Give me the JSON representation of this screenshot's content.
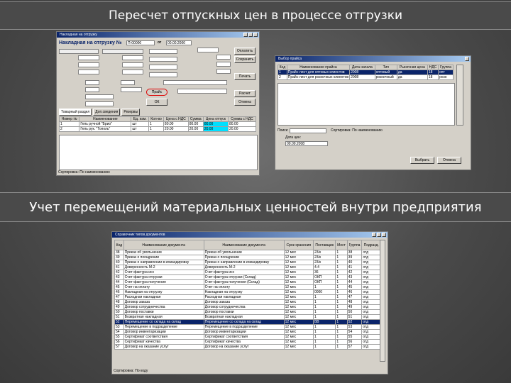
{
  "slide": {
    "heading_top": "Пересчет отпускных цен в процессе отгрузки",
    "heading_bottom": "Учет перемещений материальных ценностей внутри предприятия"
  },
  "win1": {
    "title": "Накладная на отгрузку",
    "doc_label": "Накладная на отгрузку №",
    "doc_no": "П-00000",
    "date_label": "от",
    "date": "00.00.2000",
    "ok_label": "Оплатить",
    "button_ok": "ОК",
    "button_price": "Прайс",
    "button_save": "Сохранить",
    "button_cancel": "Отмена",
    "button_print": "Печать",
    "button_calc": "Расчет",
    "tab_labels": [
      "Товарный раздел",
      "Доп.сведения",
      "Резервы"
    ],
    "table_headers": [
      "Номер №",
      "Наименование",
      "Ед. изм.",
      "Кол-во",
      "Цена с НДС",
      "Сумма",
      "Цена отпуск",
      "Сумма с НДС"
    ],
    "rows": [
      {
        "no": "1",
        "name": "Гель ручной \"Брио\"",
        "unit": "шт",
        "qty": "1",
        "price": "80.00",
        "sum": "80.00",
        "cprice": "80.00",
        "csum": "80.00"
      },
      {
        "no": "2",
        "name": "Гель рук. \"Тополь\"",
        "unit": "шт",
        "qty": "1",
        "price": "20.00",
        "sum": "20.00",
        "cprice": "20.00",
        "csum": "20.00"
      }
    ],
    "status": "Сортировка: По наименованию"
  },
  "win2": {
    "title": "Выбор прайса",
    "table_headers": [
      "Код",
      "Наименование прайса",
      "Дата начала",
      "Тип",
      "Рыночная цена",
      "НДС",
      "Группа"
    ],
    "rows": [
      {
        "code": "1",
        "name": "Прайс-лист для оптовых клиентов",
        "date": "2008",
        "type": "оптовый",
        "market": "да",
        "nds": "18",
        "group": "опт"
      },
      {
        "code": "2",
        "name": "Прайс-лист для розничных клиентов",
        "date": "2008",
        "type": "розничный",
        "market": "да",
        "nds": "18",
        "group": "розн"
      }
    ],
    "filter_label": "Поиск:",
    "sort_label": "Сортировка: По наименованию",
    "date_label": "Дата цен:",
    "date_value": "09.09.2008",
    "button_select": "Выбрать",
    "button_cancel": "Отмена"
  },
  "win3": {
    "title": "Справочник типов документов",
    "table_headers": [
      "Код",
      "Наименование документа",
      "Наименование документа",
      "Срок хранения",
      "Поставщик",
      "Мест",
      "Группа",
      "Подразд."
    ],
    "rows": [
      {
        "code": "38",
        "n1": "Приказ об увольнении",
        "n2": "Приказ об увольнении",
        "s": "12 мес",
        "p": "23/к",
        "m": "1",
        "g": "38",
        "d": "отд"
      },
      {
        "code": "39",
        "n1": "Приказ о поощрении",
        "n2": "Приказ о поощрении",
        "s": "12 мес",
        "p": "23/к",
        "m": "1",
        "g": "39",
        "d": "отд"
      },
      {
        "code": "40",
        "n1": "Приказ о направлении в командировку",
        "n2": "Приказ о направлении в командировку",
        "s": "12 мес",
        "p": "23/к",
        "m": "1",
        "g": "40",
        "d": "отд"
      },
      {
        "code": "41",
        "n1": "Доверенность М-2",
        "n2": "Доверенность М-2",
        "s": "12 мес",
        "p": "4.4",
        "m": "1",
        "g": "41",
        "d": "отд"
      },
      {
        "code": "42",
        "n1": "Счет-фактура исх",
        "n2": "Счет-фактура исх",
        "s": "12 мес",
        "p": "36",
        "m": "1",
        "g": "42",
        "d": "отд"
      },
      {
        "code": "43",
        "n1": "Счет-фактура отгрузки",
        "n2": "Счет-фактура отгрузки (Склад)",
        "s": "12 мес",
        "p": "ОКП",
        "m": "1",
        "g": "43",
        "d": "отд"
      },
      {
        "code": "44",
        "n1": "Счет-фактура получения",
        "n2": "Счет-фактура получения (Склад)",
        "s": "12 мес",
        "p": "ОКП",
        "m": "1",
        "g": "44",
        "d": "отд"
      },
      {
        "code": "45",
        "n1": "Счет на оплату",
        "n2": "Счет на оплату",
        "s": "12 мес",
        "p": "1",
        "m": "1",
        "g": "45",
        "d": "отд"
      },
      {
        "code": "46",
        "n1": "Накладная на отгрузку",
        "n2": "Накладная на отгрузку",
        "s": "12 мес",
        "p": "0000",
        "m": "1",
        "g": "46",
        "d": "отд"
      },
      {
        "code": "47",
        "n1": "Расходная накладная",
        "n2": "Расходная накладная",
        "s": "12 мес",
        "p": "1",
        "m": "1",
        "g": "47",
        "d": "отд"
      },
      {
        "code": "48",
        "n1": "Договор заказа",
        "n2": "Договор заказа",
        "s": "12 мес",
        "p": "1",
        "m": "1",
        "g": "48",
        "d": "отд"
      },
      {
        "code": "49",
        "n1": "Договор сотрудничества",
        "n2": "Договор сотрудничества",
        "s": "12 мес",
        "p": "1",
        "m": "1",
        "g": "49",
        "d": "отд"
      },
      {
        "code": "50",
        "n1": "Договор поставки",
        "n2": "Договор поставки",
        "s": "12 мес",
        "p": "1",
        "m": "1",
        "g": "50",
        "d": "отд"
      },
      {
        "code": "51",
        "n1": "Возвратная накладная",
        "n2": "Возвратная накладная",
        "s": "12 мес",
        "p": "1",
        "m": "1",
        "g": "51",
        "d": "отд"
      },
      {
        "code": "52",
        "n1": "Перемещение со склада на склад",
        "n2": "Перемещение со склада на склад",
        "s": "12 мес",
        "p": "ВВ",
        "m": "1",
        "g": "52",
        "d": "отд"
      },
      {
        "code": "53",
        "n1": "Перемещение в подразделение",
        "n2": "Перемещение в подразделение",
        "s": "12 мес",
        "p": "1",
        "m": "1",
        "g": "53",
        "d": "отд"
      },
      {
        "code": "54",
        "n1": "Договор инвентаризации",
        "n2": "Договор инвентаризации",
        "s": "12 мес",
        "p": "1",
        "m": "1",
        "g": "54",
        "d": "отд"
      },
      {
        "code": "55",
        "n1": "Сертификат соответствия",
        "n2": "Сертификат соответствия",
        "s": "12 мес",
        "p": "1",
        "m": "1",
        "g": "55",
        "d": "отд"
      },
      {
        "code": "56",
        "n1": "Сертификат качества",
        "n2": "Сертификат качества",
        "s": "12 мес",
        "p": "1",
        "m": "1",
        "g": "56",
        "d": "отд"
      },
      {
        "code": "57",
        "n1": "Договор на оказание услуг",
        "n2": "Договор на оказание услуг",
        "s": "12 мес",
        "p": "1",
        "m": "1",
        "g": "57",
        "d": "отд"
      }
    ],
    "selected_index": 14,
    "status": "Сортировка: По коду"
  }
}
